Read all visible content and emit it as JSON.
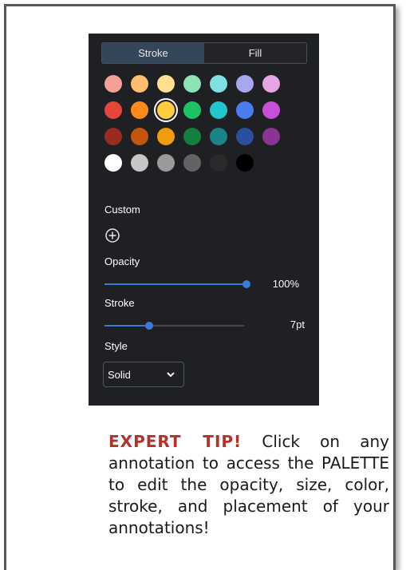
{
  "tabs": {
    "stroke": "Stroke",
    "fill": "Fill",
    "active": "stroke"
  },
  "swatch_rows": [
    [
      "#f4a097",
      "#ffbd72",
      "#ffe090",
      "#8ee2b5",
      "#7fdfe2",
      "#a7a7ee",
      "#e3a6e3"
    ],
    [
      "#e8453a",
      "#ff8a1c",
      "#ffcc40",
      "#1ec266",
      "#22c7cc",
      "#4b7cf0",
      "#c850d8"
    ],
    [
      "#9a2a22",
      "#c4550f",
      "#ef9d0c",
      "#14803f",
      "#1a8487",
      "#2a4f9e",
      "#8a3596"
    ],
    [
      "#ffffff",
      "#c6c6c6",
      "#9a9a9a",
      "#636363",
      "#2a2a2a",
      "#000000"
    ]
  ],
  "selected_color": "#ffcc40",
  "custom_label": "Custom",
  "opacity": {
    "label": "Opacity",
    "value_text": "100%",
    "level": 1.0
  },
  "stroke": {
    "label": "Stroke",
    "value_text": "7pt",
    "level": 0.32
  },
  "style": {
    "label": "Style",
    "selected": "Solid"
  },
  "tip": {
    "heading": "EXPERT TIP!",
    "body": "Click on any annotation to access the PALETTE to edit the opacity, size, color, stroke, and placement of your annotations!"
  },
  "icons": {
    "add": "plus-circle-icon",
    "dropdown": "chevron-down-icon"
  }
}
